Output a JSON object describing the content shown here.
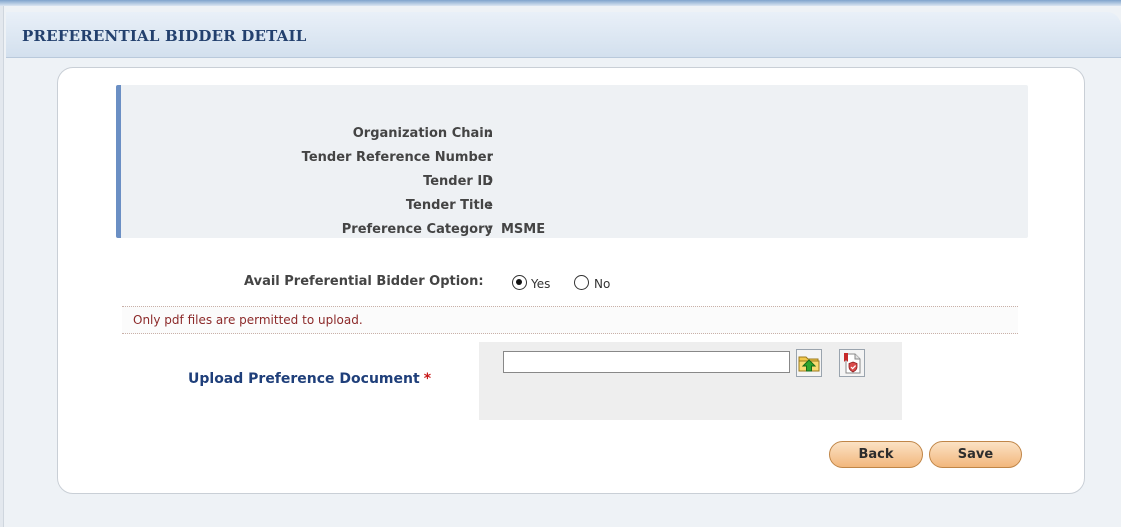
{
  "header": {
    "title": "PREFERENTIAL BIDDER DETAIL"
  },
  "info": {
    "rows": [
      {
        "label": "Organization Chain",
        "value": ""
      },
      {
        "label": "Tender Reference Number",
        "value": ""
      },
      {
        "label": "Tender ID",
        "value": ""
      },
      {
        "label": "Tender Title",
        "value": ""
      },
      {
        "label": "Preference Category",
        "value": "MSME"
      }
    ],
    "colon": ":"
  },
  "avail": {
    "label": "Avail Preferential Bidder Option:",
    "options": [
      {
        "label": "Yes",
        "selected": true
      },
      {
        "label": "No",
        "selected": false
      }
    ]
  },
  "notice": {
    "text": "Only pdf files are permitted to upload."
  },
  "upload": {
    "label": "Upload Preference Document",
    "required_mark": "*",
    "value": "",
    "browse_icon": "folder-upload-icon",
    "sign_icon": "signed-document-icon"
  },
  "actions": {
    "back_label": "Back",
    "save_label": "Save"
  },
  "colors": {
    "accent": "#6b8fc4",
    "title": "#23406e",
    "notice": "#8c2a2a",
    "button": "#f2b77d"
  }
}
